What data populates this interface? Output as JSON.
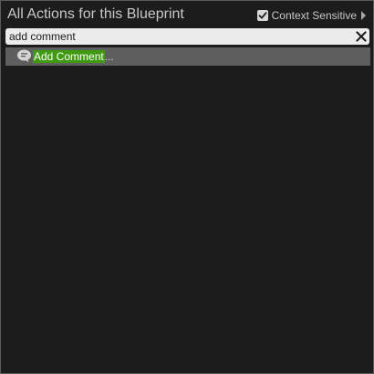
{
  "header": {
    "title": "All Actions for this Blueprint",
    "context_label": "Context Sensitive",
    "context_checked": true
  },
  "search": {
    "value": "add comment",
    "placeholder": ""
  },
  "results": [
    {
      "icon": "comment-icon",
      "match_text": "Add Comment",
      "rest_text": "..."
    }
  ],
  "colors": {
    "panel_bg": "#1c1c1c",
    "highlight": "#3f9a12",
    "selected_row": "#5e5e5e",
    "search_bg": "#ececec"
  }
}
